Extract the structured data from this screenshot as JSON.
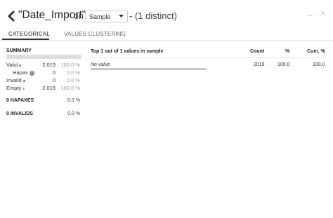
{
  "header": {
    "title": "\"Date_Import\"",
    "on_label": "on",
    "sample_select": "Sample",
    "distinct": "- (1 distinct)"
  },
  "tabs": [
    {
      "label": "CATEGORICAL",
      "active": true
    },
    {
      "label": "VALUES CLUSTERING",
      "active": false
    }
  ],
  "summary": {
    "title": "SUMMARY",
    "rows": [
      {
        "label": "Valid",
        "count": "2,019",
        "pct": "100.0 %",
        "dot": "#5aa35a"
      },
      {
        "label": "Hapax",
        "count": "0",
        "pct": "0.0 %",
        "dot": ""
      },
      {
        "label": "Invalid",
        "count": "0",
        "pct": "0.0 %",
        "dot": "#d9534f"
      },
      {
        "label": "Empty",
        "count": "2,019",
        "pct": "100.0 %",
        "dot": "#aaaaaa"
      }
    ],
    "stats": [
      {
        "label": "0 HAPAXES",
        "pct": "0.0 %"
      },
      {
        "label": "0 INVALIDS",
        "pct": "0.0 %"
      }
    ]
  },
  "table": {
    "heading": "Top 1 out of 1 values in sample",
    "col_count": "Count",
    "col_pct": "%",
    "col_cum": "Cum. %",
    "rows": [
      {
        "value": "No value",
        "count": "2019",
        "pct": "100.0",
        "cum": "100.0",
        "share": 1.0
      }
    ]
  },
  "icons": {
    "back": "chevron-left-icon",
    "minimize": "minimize-icon",
    "close": "close-icon",
    "info": "info-icon"
  }
}
